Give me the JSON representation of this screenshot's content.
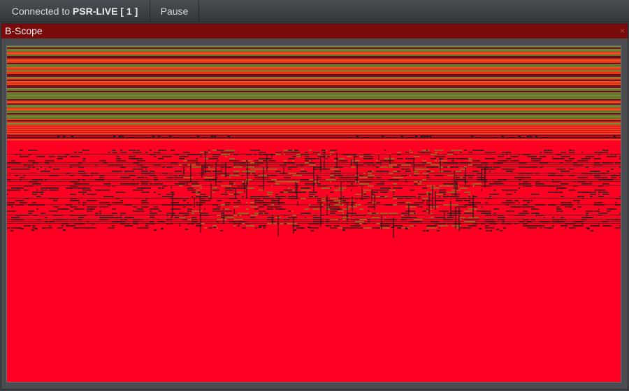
{
  "toolbar": {
    "connected_prefix": "Connected to ",
    "connected_target": "PSR-LIVE [ 1 ]",
    "pause_label": "Pause"
  },
  "panel": {
    "title": "B-Scope",
    "close_glyph": "×"
  },
  "colors": {
    "background": "#ff0022",
    "green": "#19c43a",
    "orange": "#d66a1a",
    "dark": "#1a1a1a"
  }
}
